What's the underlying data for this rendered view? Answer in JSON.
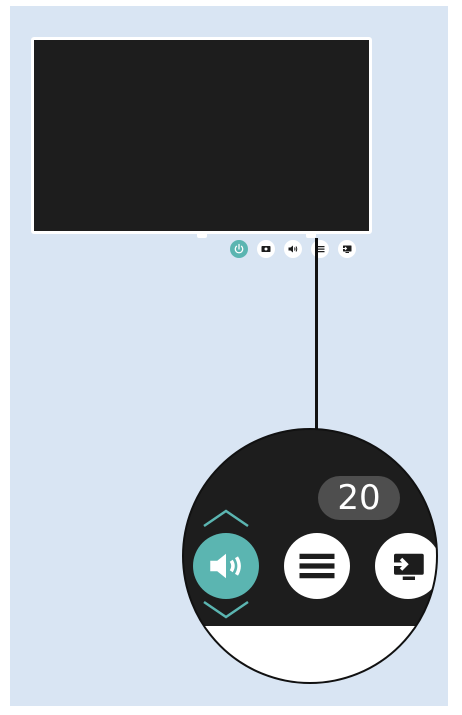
{
  "tv": {
    "buttons": [
      {
        "name": "power-icon",
        "active": true
      },
      {
        "name": "source-icon",
        "active": false
      },
      {
        "name": "volume-icon",
        "active": false
      },
      {
        "name": "menu-icon",
        "active": false
      },
      {
        "name": "input-icon",
        "active": false
      }
    ]
  },
  "zoom": {
    "volume_level": "20",
    "selected_control": "volume",
    "controls": [
      "volume",
      "menu",
      "input"
    ]
  },
  "colors": {
    "background": "#d9e5f3",
    "tv_screen": "#1d1d1d",
    "accent": "#5bb5b1",
    "badge": "#4e4e4e"
  }
}
